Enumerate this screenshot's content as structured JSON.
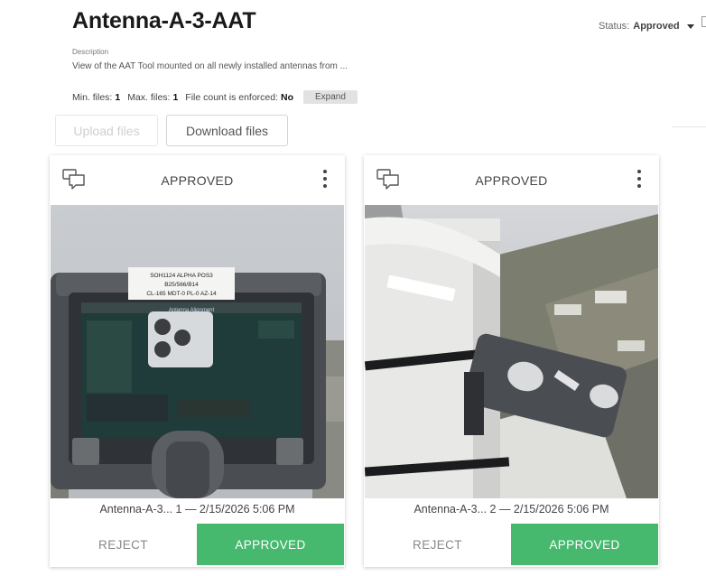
{
  "header": {
    "title": "Antenna-A-3-AAT",
    "status_label": "Status:",
    "status_value": "Approved",
    "description_label": "Description",
    "description": "View of the AAT Tool mounted on all newly installed antennas from ..."
  },
  "meta": {
    "min_files_label": "Min. files:",
    "min_files": "1",
    "max_files_label": "Max. files:",
    "max_files": "1",
    "enforced_label": "File count is enforced:",
    "enforced": "No",
    "expand_label": "Expand"
  },
  "toolbar": {
    "upload_label": "Upload files",
    "download_label": "Download files"
  },
  "cards": [
    {
      "state": "APPROVED",
      "caption": "Antenna-A-3... 1 — 2/15/2026 5:06 PM",
      "reject_label": "REJECT",
      "approve_label": "APPROVED",
      "photo_label_lines": [
        "SOH1124 ALPHA POS3",
        "B25/566/B14",
        "CL-165 MDT-0 PL-0 AZ-14"
      ],
      "device_screen_title": "Antenna Alignment"
    },
    {
      "state": "APPROVED",
      "caption": "Antenna-A-3... 2 — 2/15/2026 5:06 PM",
      "reject_label": "REJECT",
      "approve_label": "APPROVED"
    }
  ],
  "colors": {
    "approve": "#46b96e",
    "text_dark": "#1a1a1a"
  },
  "icons": {
    "comment": "comment-icon",
    "more": "more-vertical-icon",
    "caret": "caret-down-icon"
  }
}
